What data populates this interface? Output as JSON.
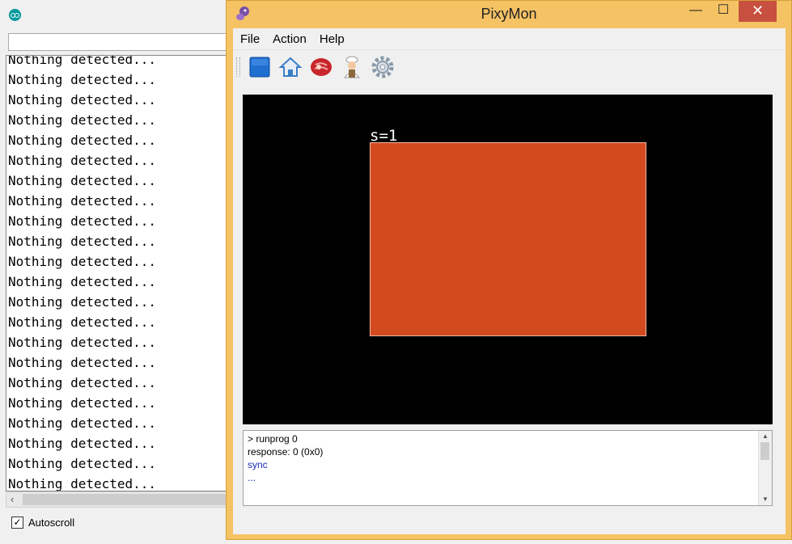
{
  "serial_monitor": {
    "input_value": "",
    "lines": [
      "Nothing detected...",
      "Nothing detected...",
      "Nothing detected...",
      "Nothing detected...",
      "Nothing detected...",
      "Nothing detected...",
      "Nothing detected...",
      "Nothing detected...",
      "Nothing detected...",
      "Nothing detected...",
      "Nothing detected...",
      "Nothing detected...",
      "Nothing detected...",
      "Nothing detected...",
      "Nothing detected...",
      "Nothing detected...",
      "Nothing detected...",
      "Nothing detected...",
      "Nothing detected...",
      "Nothing detected...",
      "Nothing detected...",
      "Nothing detected...",
      "Nothing de"
    ],
    "autoscroll_label": "Autoscroll",
    "autoscroll_checked": true,
    "app_icon": "arduino-icon"
  },
  "pixymon": {
    "title": "PixyMon",
    "window_buttons": {
      "minimize": "—",
      "maximize": "☐",
      "close": "✕"
    },
    "menu": [
      "File",
      "Action",
      "Help"
    ],
    "toolbar": [
      "stop-icon",
      "home-icon",
      "raw-meat-icon",
      "cooked-chef-icon",
      "settings-icon"
    ],
    "video": {
      "blob_label": "s=1",
      "blob_color": "#d34a1f"
    },
    "console": [
      {
        "text": "> runprog 0",
        "color": "#000000"
      },
      {
        "text": "response: 0 (0x0)",
        "color": "#000000"
      },
      {
        "text": "sync",
        "color": "#1a2ab8"
      },
      {
        "text": "...",
        "color": "#1a2ab8"
      }
    ]
  }
}
